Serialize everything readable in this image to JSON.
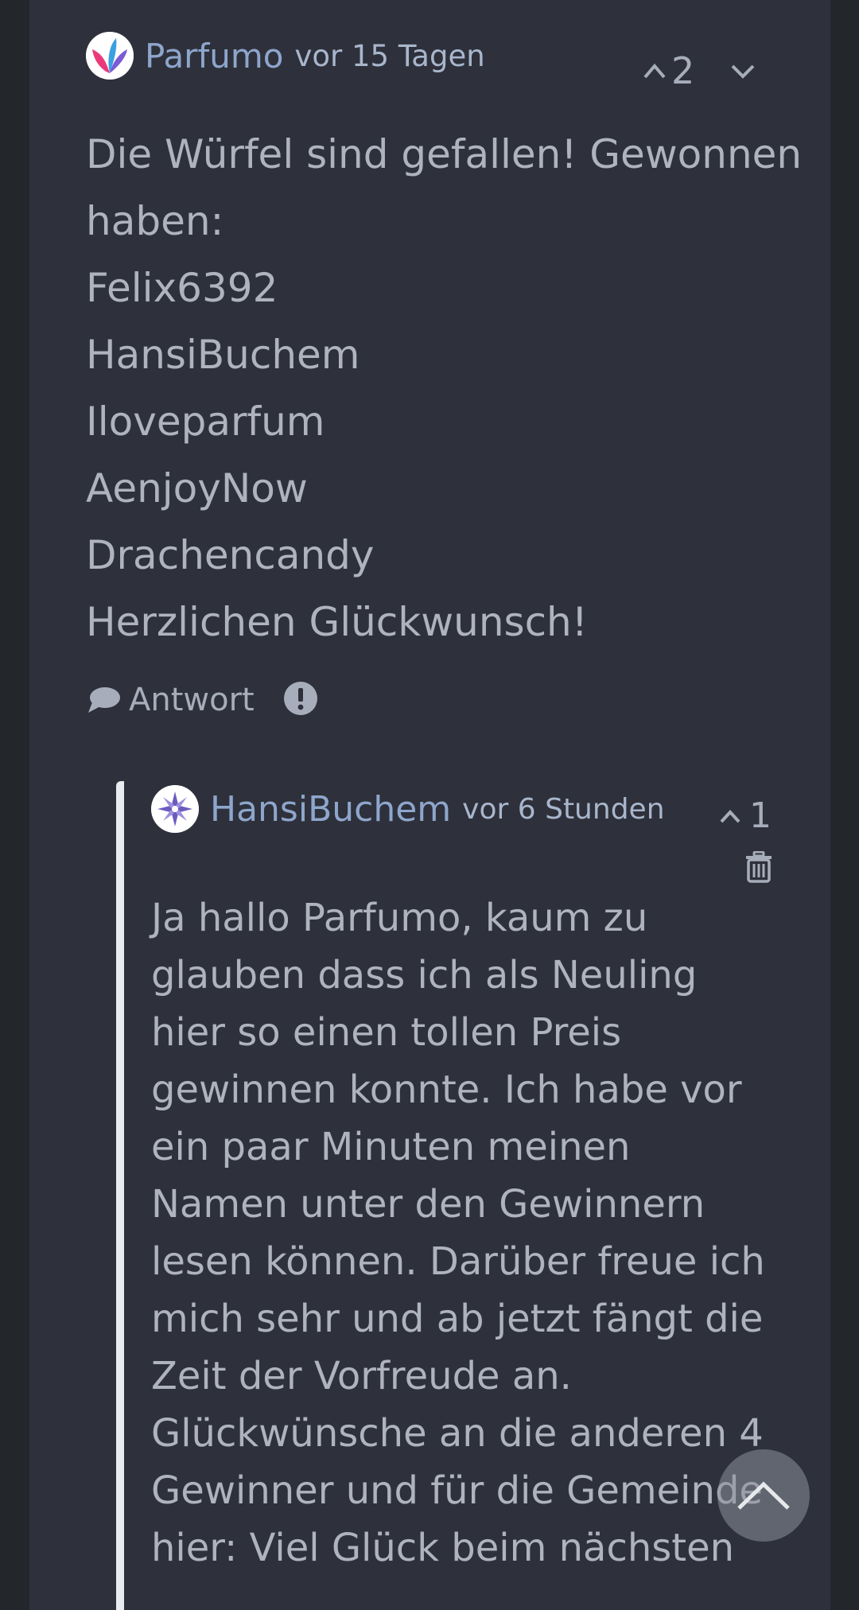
{
  "post": {
    "author": "Parfumo",
    "time": "vor 15 Tagen",
    "votes": "2",
    "lines": [
      "Die Würfel sind gefallen! Gewonnen",
      "haben:",
      "Felix6392",
      "HansiBuchem",
      "Iloveparfum",
      "AenjoyNow",
      "Drachencandy",
      "Herzlichen Glückwunsch!"
    ],
    "reply_label": "Antwort"
  },
  "reply": {
    "author": "HansiBuchem",
    "time": "vor 6 Stunden",
    "votes": "1",
    "lines": [
      "Ja hallo Parfumo, kaum zu",
      "glauben dass ich als Neuling",
      "hier so einen tollen Preis",
      "gewinnen konnte. Ich habe vor",
      "ein paar Minuten meinen",
      "Namen unter den Gewinnern",
      "lesen können. Darüber freue ich",
      "mich sehr und ab jetzt fängt die",
      "Zeit der Vorfreude an.",
      "Glückwünsche an die anderen 4",
      "Gewinner und für die Gemeinde",
      "hier: Viel Glück beim nächsten"
    ]
  },
  "icons": {
    "post_avatar": "parfumo-logo",
    "reply_avatar": "star-emblem-avatar",
    "upvote": "chevron-up-icon",
    "downvote": "chevron-down-icon",
    "reply": "speech-bubble-icon",
    "report": "exclamation-circle-icon",
    "delete": "trash-icon",
    "scroll_top": "chevron-up-icon"
  }
}
